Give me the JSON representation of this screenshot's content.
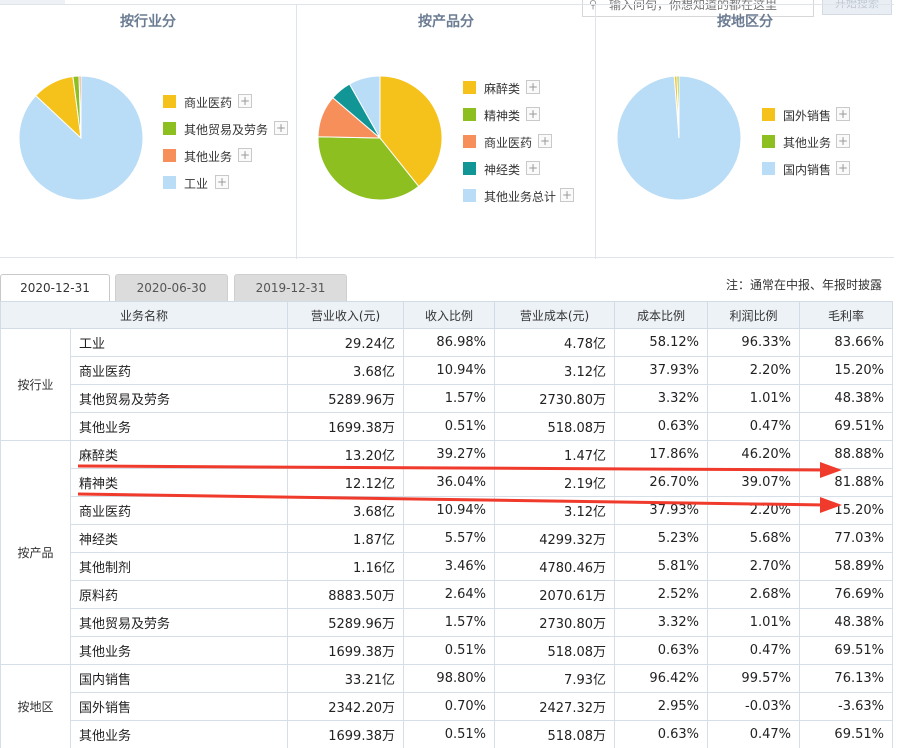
{
  "search": {
    "placeholder": "输入问句，你想知道的都在这里",
    "button_label": "开始搜索",
    "icon": "search-icon"
  },
  "panels": [
    {
      "title": "按行业分",
      "legend": [
        {
          "label": "商业医药",
          "color": "#f5c21b"
        },
        {
          "label": "其他贸易及劳务",
          "color": "#8cbf1f"
        },
        {
          "label": "其他业务",
          "color": "#f78f5a"
        },
        {
          "label": "工业",
          "color": "#b9dcf7"
        }
      ],
      "pie": [
        {
          "label": "工业",
          "value": 86.98,
          "color": "#b9dcf7"
        },
        {
          "label": "商业医药",
          "value": 10.94,
          "color": "#f5c21b"
        },
        {
          "label": "其他贸易及劳务",
          "value": 1.57,
          "color": "#8cbf1f"
        },
        {
          "label": "其他业务",
          "value": 0.51,
          "color": "#f78f5a"
        }
      ]
    },
    {
      "title": "按产品分",
      "legend": [
        {
          "label": "麻醉类",
          "color": "#f5c21b"
        },
        {
          "label": "精神类",
          "color": "#8cbf1f"
        },
        {
          "label": "商业医药",
          "color": "#f78f5a"
        },
        {
          "label": "神经类",
          "color": "#129595"
        },
        {
          "label": "其他业务总计",
          "color": "#b9dcf7"
        }
      ],
      "pie": [
        {
          "label": "麻醉类",
          "value": 39.27,
          "color": "#f5c21b"
        },
        {
          "label": "精神类",
          "value": 36.04,
          "color": "#8cbf1f"
        },
        {
          "label": "商业医药",
          "value": 10.94,
          "color": "#f78f5a"
        },
        {
          "label": "神经类",
          "value": 5.57,
          "color": "#129595"
        },
        {
          "label": "其他业务总计",
          "value": 8.18,
          "color": "#b9dcf7"
        }
      ]
    },
    {
      "title": "按地区分",
      "legend": [
        {
          "label": "国外销售",
          "color": "#f5c21b"
        },
        {
          "label": "其他业务",
          "color": "#8cbf1f"
        },
        {
          "label": "国内销售",
          "color": "#b9dcf7"
        }
      ],
      "pie": [
        {
          "label": "国内销售",
          "value": 98.8,
          "color": "#b9dcf7"
        },
        {
          "label": "国外销售",
          "value": 0.7,
          "color": "#f5c21b"
        },
        {
          "label": "其他业务",
          "value": 0.51,
          "color": "#8cbf1f"
        }
      ]
    }
  ],
  "tabs": [
    "2020-12-31",
    "2020-06-30",
    "2019-12-31"
  ],
  "active_tab": 0,
  "note": "注：通常在中报、年报时披露",
  "table": {
    "headers": [
      "业务名称",
      "营业收入(元)",
      "收入比例",
      "营业成本(元)",
      "成本比例",
      "利润比例",
      "毛利率"
    ],
    "groups": [
      {
        "label": "按行业",
        "rows": [
          [
            "工业",
            "29.24亿",
            "86.98%",
            "4.78亿",
            "58.12%",
            "96.33%",
            "83.66%"
          ],
          [
            "商业医药",
            "3.68亿",
            "10.94%",
            "3.12亿",
            "37.93%",
            "2.20%",
            "15.20%"
          ],
          [
            "其他贸易及劳务",
            "5289.96万",
            "1.57%",
            "2730.80万",
            "3.32%",
            "1.01%",
            "48.38%"
          ],
          [
            "其他业务",
            "1699.38万",
            "0.51%",
            "518.08万",
            "0.63%",
            "0.47%",
            "69.51%"
          ]
        ]
      },
      {
        "label": "按产品",
        "rows": [
          [
            "麻醉类",
            "13.20亿",
            "39.27%",
            "1.47亿",
            "17.86%",
            "46.20%",
            "88.88%"
          ],
          [
            "精神类",
            "12.12亿",
            "36.04%",
            "2.19亿",
            "26.70%",
            "39.07%",
            "81.88%"
          ],
          [
            "商业医药",
            "3.68亿",
            "10.94%",
            "3.12亿",
            "37.93%",
            "2.20%",
            "15.20%"
          ],
          [
            "神经类",
            "1.87亿",
            "5.57%",
            "4299.32万",
            "5.23%",
            "5.68%",
            "77.03%"
          ],
          [
            "其他制剂",
            "1.16亿",
            "3.46%",
            "4780.46万",
            "5.81%",
            "2.70%",
            "58.89%"
          ],
          [
            "原料药",
            "8883.50万",
            "2.64%",
            "2070.61万",
            "2.52%",
            "2.68%",
            "76.69%"
          ],
          [
            "其他贸易及劳务",
            "5289.96万",
            "1.57%",
            "2730.80万",
            "3.32%",
            "1.01%",
            "48.38%"
          ],
          [
            "其他业务",
            "1699.38万",
            "0.51%",
            "518.08万",
            "0.63%",
            "0.47%",
            "69.51%"
          ]
        ]
      },
      {
        "label": "按地区",
        "rows": [
          [
            "国内销售",
            "33.21亿",
            "98.80%",
            "7.93亿",
            "96.42%",
            "99.57%",
            "76.13%"
          ],
          [
            "国外销售",
            "2342.20万",
            "0.70%",
            "2427.32万",
            "2.95%",
            "-0.03%",
            "-3.63%"
          ],
          [
            "其他业务",
            "1699.38万",
            "0.51%",
            "518.08万",
            "0.63%",
            "0.47%",
            "69.51%"
          ]
        ]
      }
    ]
  },
  "annotation_color": "#f03a2c"
}
